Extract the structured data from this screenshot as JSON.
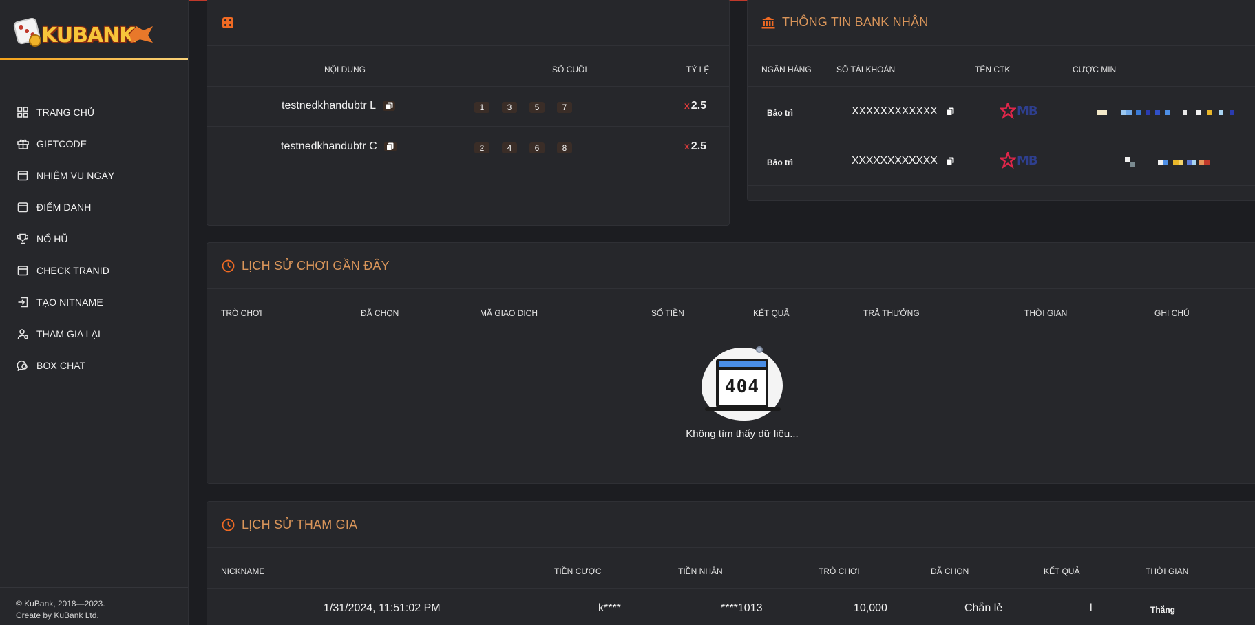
{
  "brand": {
    "logo_text": "KUBANK"
  },
  "sidebar": {
    "items": [
      {
        "label": "TRANG CHỦ",
        "icon": "grid-icon"
      },
      {
        "label": "GIFTCODE",
        "icon": "gift-icon"
      },
      {
        "label": "NHIỆM VỤ NGÀY",
        "icon": "calendar-icon"
      },
      {
        "label": "ĐIỂM DANH",
        "icon": "calendar-check-icon"
      },
      {
        "label": "NỔ HŨ",
        "icon": "trophy-icon"
      },
      {
        "label": "CHECK TRANID",
        "icon": "calendar-search-icon"
      },
      {
        "label": "TẠO NITNAME",
        "icon": "login-icon"
      },
      {
        "label": "THAM GIA LẠI",
        "icon": "user-gear-icon"
      },
      {
        "label": "BOX CHAT",
        "icon": "chat-icon"
      }
    ],
    "footer_line1": "© KuBank, 2018—2023.",
    "footer_line2": "Create by KuBank Ltd."
  },
  "rules": {
    "icon": "dice-icon",
    "headers": {
      "content": "NỘI DUNG",
      "last_digits": "SỐ CUỐI",
      "ratio": "TỶ LỆ"
    },
    "rows": [
      {
        "content": "testnedkhandubtr L",
        "digits": [
          "1",
          "3",
          "5",
          "7"
        ],
        "x": "x",
        "ratio": "2.5"
      },
      {
        "content": "testnedkhandubtr C",
        "digits": [
          "2",
          "4",
          "6",
          "8"
        ],
        "x": "x",
        "ratio": "2.5"
      }
    ]
  },
  "bank": {
    "title": "THÔNG TIN BANK NHẬN",
    "icon": "bank-icon",
    "headers": {
      "bank": "NGÂN HÀNG",
      "account": "SỐ TÀI KHOẢN",
      "name": "TÊN CTK",
      "min": "CƯỢC MIN"
    },
    "rows": [
      {
        "status": "Bảo trì",
        "account": "XXXXXXXXXXXX",
        "bank_logo": "MB"
      },
      {
        "status": "Bảo trì",
        "account": "XXXXXXXXXXXX",
        "bank_logo": "MB"
      }
    ],
    "colors": {
      "mb_red": "#e0264a",
      "mb_blue": "#2e3f8f"
    }
  },
  "recent": {
    "title": "LỊCH SỬ CHƠI GẦN ĐÂY",
    "icon": "clock-icon",
    "headers": [
      "TRÒ CHƠI",
      "ĐÃ CHỌN",
      "MÃ GIAO DỊCH",
      "SỐ TIỀN",
      "KẾT QUẢ",
      "TRẢ THƯỞNG",
      "THỜI GIAN",
      "GHI CHÚ"
    ],
    "empty_code": "404",
    "empty_text": "Không tìm thấy dữ liệu..."
  },
  "joined": {
    "title": "LỊCH SỬ THAM GIA",
    "icon": "clock-icon",
    "headers": [
      "NICKNAME",
      "TIỀN CƯỢC",
      "TIỀN NHẬN",
      "TRÒ CHƠI",
      "ĐÃ CHỌN",
      "KẾT QUẢ",
      "THỜI GIAN"
    ],
    "row": {
      "time": "1/31/2024, 11:51:02 PM",
      "nickname": "k****",
      "account": "****1013",
      "amount": "10,000",
      "game": "Chẵn lẻ",
      "choice": "l",
      "result": "Thắng"
    }
  },
  "theme": {
    "accent": "#d9955a",
    "orange": "#f06a23",
    "bg": "#1c1d21",
    "panel": "#26272b"
  }
}
